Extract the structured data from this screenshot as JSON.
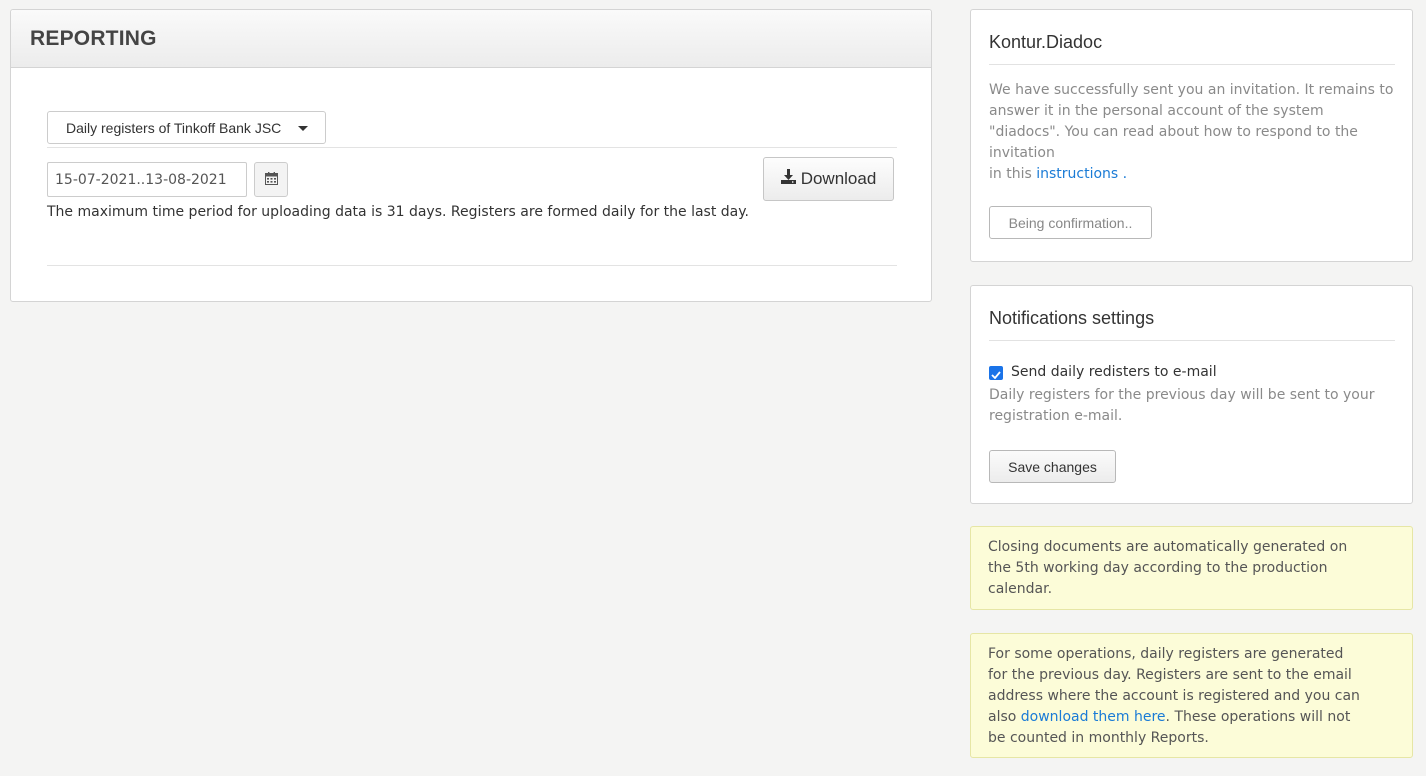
{
  "reporting": {
    "title": "REPORTING",
    "register_select": "Daily registers of Tinkoff Bank JSC",
    "date_range": "15-07-2021..13-08-2021",
    "download_label": "Download",
    "hint": "The maximum time period for uploading data is 31 days. Registers are formed daily for the last day."
  },
  "diadoc": {
    "title": "Kontur.Diadoc",
    "message": "We have successfully sent you an invitation. It remains to answer it in the personal account of the system \"diadocs\". You can read about how to respond to the invitation",
    "message_prefix": "in this",
    "instructions_link": "instructions",
    "message_suffix": ".",
    "confirm_button": "Being confirmation.."
  },
  "notifications": {
    "title": "Notifications settings",
    "checkbox_label": "Send daily redisters to e-mail",
    "checkbox_checked": true,
    "description": "Daily registers for the previous day will be sent to your registration e-mail.",
    "save_button": "Save changes"
  },
  "notes": {
    "closing_docs": "Closing documents are automatically generated on the 5th working day according to the production calendar.",
    "operations_prefix": "For some operations, daily registers are generated for the previous day. Registers are sent to the email address where the account is registered and you can also",
    "operations_link": "download them here",
    "operations_suffix": ". These operations will not be counted in monthly Reports."
  },
  "icons": {
    "calendar": "calendar-icon",
    "download": "download-icon",
    "caret": "caret-down-icon",
    "check": "check-icon"
  },
  "colors": {
    "link": "#1a7bd6",
    "note_background": "#fcfcd8",
    "checkbox": "#1a73e8"
  }
}
